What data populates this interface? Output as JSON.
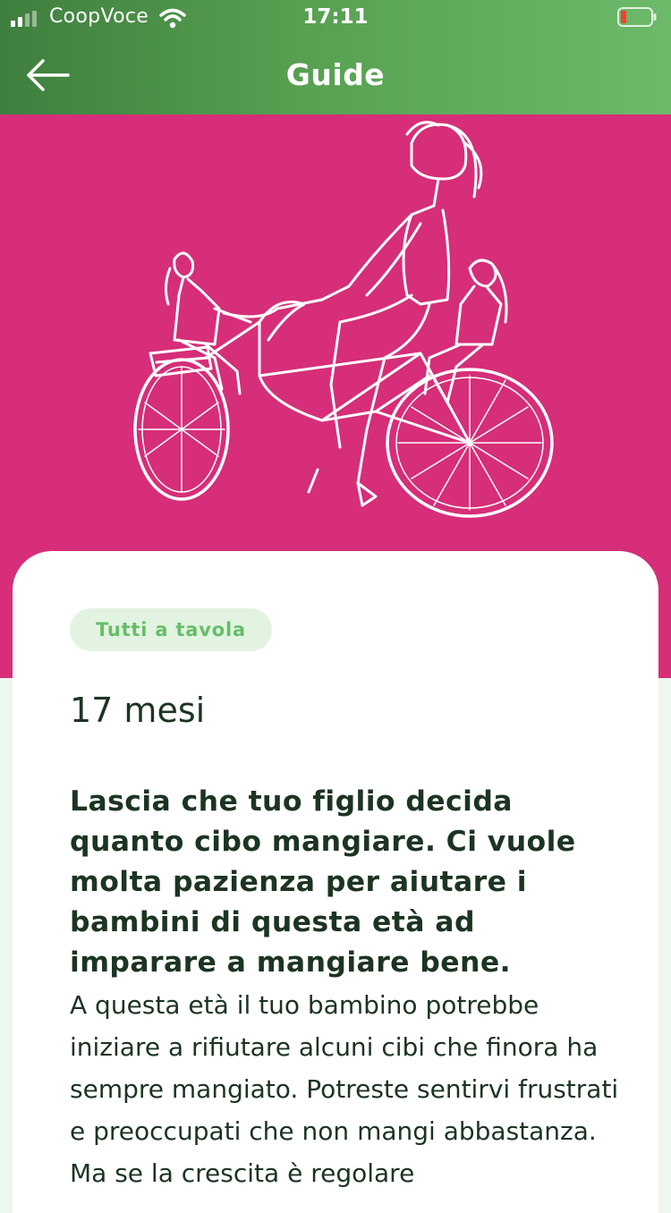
{
  "status_bar": {
    "carrier": "CoopVoce",
    "time": "17:11",
    "signal_icon": "cellular-signal-icon",
    "wifi_icon": "wifi-icon",
    "battery_icon": "battery-low-icon"
  },
  "header": {
    "title": "Guide",
    "back_icon": "arrow-left-icon"
  },
  "hero": {
    "illustration": "woman-riding-bicycle-with-two-children-drawing"
  },
  "article": {
    "category_tag": "Tutti a tavola",
    "age": "17 mesi",
    "headline": "Lascia che tuo figlio decida quanto cibo mangiare. Ci vuole molta pazienza per aiutare i bambini di questa età ad imparare a mangiare bene.",
    "body": "A questa età il tuo bambino potrebbe iniziare a rifiutare alcuni cibi che finora ha sempre mangiato. Potreste sentirvi frustrati e preoccupati che non mangi abbastanza. Ma se la crescita è regolare"
  },
  "colors": {
    "header_gradient_start": "#3f7f3e",
    "header_gradient_end": "#6dba6a",
    "hero_background": "#d62e78",
    "tag_background": "#e2f4e1",
    "tag_text": "#67bd69",
    "text_dark": "#1c3422"
  }
}
